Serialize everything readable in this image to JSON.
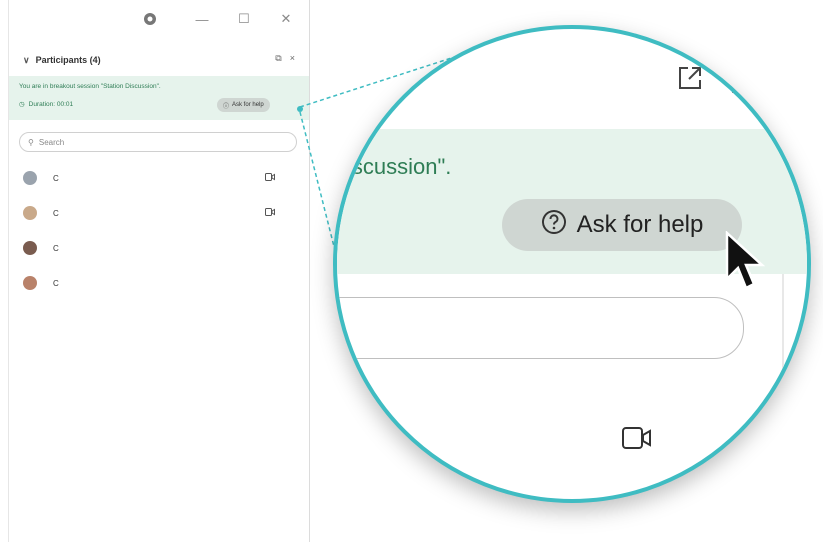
{
  "window": {
    "minimize_glyph": "—",
    "maximize_glyph": "☐",
    "close_glyph": "✕"
  },
  "participants": {
    "header_label": "Participants (4)",
    "popout_glyph": "⧉",
    "close_glyph": "×",
    "banner_line1": "You are in breakout session \"Station Discussion\".",
    "banner_duration": "Duration: 00:01",
    "ask_for_help_small": "Ask for help",
    "search_placeholder": "Search",
    "list": [
      {
        "name": "C",
        "camera": true,
        "avatar_color": "#9aa3ad"
      },
      {
        "name": "C",
        "camera": true,
        "avatar_color": "#c9a98a"
      },
      {
        "name": "C",
        "camera": false,
        "avatar_color": "#7a5c4f"
      },
      {
        "name": "C",
        "camera": false,
        "avatar_color": "#b9826a"
      }
    ]
  },
  "magnifier": {
    "zoom_text": "iscussion\".",
    "ask_for_help": "Ask for help",
    "close_glyph": "/"
  },
  "colors": {
    "accent_teal": "#3fbcc2",
    "banner_green_bg": "#e6f3ec",
    "banner_green_text": "#2e7d55",
    "help_button_bg": "#cfd6d2"
  }
}
